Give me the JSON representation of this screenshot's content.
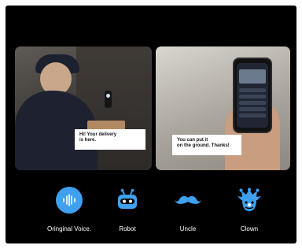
{
  "bubbles": {
    "delivery": [
      "Hi! Your delivery",
      "is here."
    ],
    "reply": [
      "You can put it",
      "on the ground. Thanks!"
    ]
  },
  "voices": [
    {
      "label": "Oringinal Voice.",
      "icon": "voice-wave-icon"
    },
    {
      "label": "Robot",
      "icon": "robot-icon"
    },
    {
      "label": "Uncle",
      "icon": "mustache-icon"
    },
    {
      "label": "Clown",
      "icon": "clown-icon"
    }
  ],
  "colors": {
    "accent": "#3fa0f0",
    "background": "#000000",
    "text": "#ffffff"
  }
}
